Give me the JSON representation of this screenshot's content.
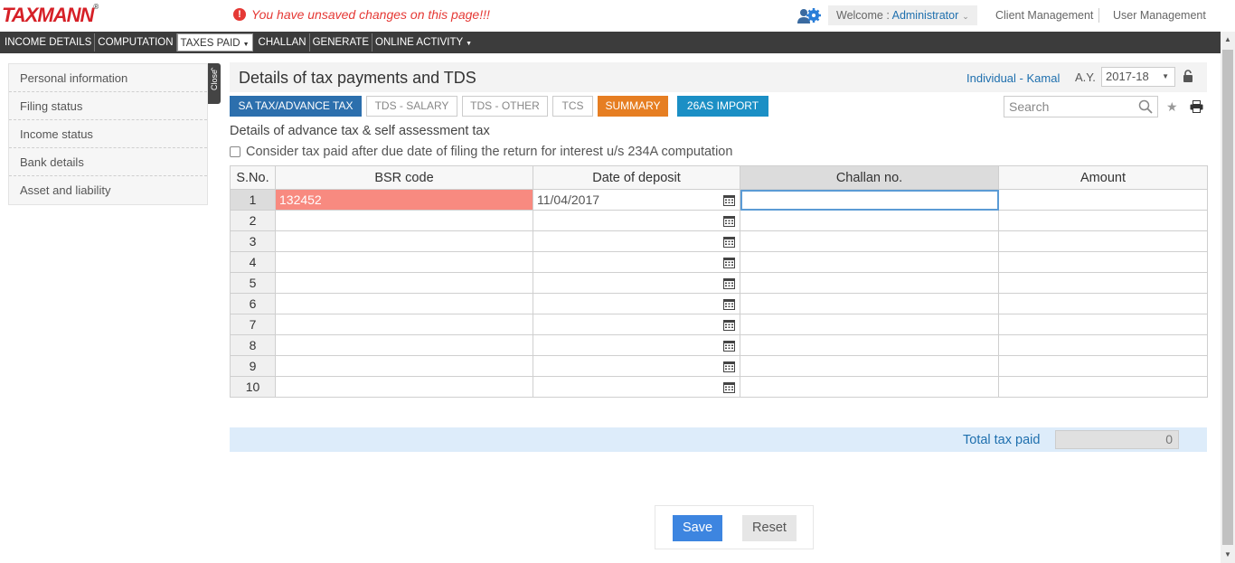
{
  "header": {
    "logo": "TAXMANN",
    "logo_reg": "®",
    "unsaved_message": "You have unsaved changes on this page!!!",
    "welcome_prefix": "Welcome : ",
    "welcome_user": "Administrator",
    "client_management": "Client Management",
    "user_management": "User Management"
  },
  "nav": {
    "items": [
      "INCOME DETAILS",
      "COMPUTATION",
      "TAXES PAID",
      "CHALLAN",
      "GENERATE",
      "ONLINE ACTIVITY"
    ]
  },
  "sidebar": {
    "items": [
      "Personal information",
      "Filing status",
      "Income status",
      "Bank details",
      "Asset and liability"
    ],
    "close_label": "Close"
  },
  "main": {
    "title": "Details of tax payments and TDS",
    "individual": "Individual - Kamal",
    "ay_label": "A.Y.",
    "ay_value": "2017-18",
    "tabs": [
      "SA TAX/ADVANCE TAX",
      "TDS - SALARY",
      "TDS - OTHER",
      "TCS",
      "SUMMARY",
      "26AS IMPORT"
    ],
    "search_placeholder": "Search",
    "section_title": "Details of advance tax & self assessment tax",
    "checkbox_label": "Consider tax paid after due date of filing the return for interest u/s 234A computation"
  },
  "table": {
    "headers": [
      "S.No.",
      "BSR code",
      "Date of deposit",
      "Challan no.",
      "Amount"
    ],
    "rows": [
      [
        "1",
        "132452",
        "11/04/2017",
        "",
        ""
      ],
      [
        "2",
        "",
        "",
        "",
        ""
      ],
      [
        "3",
        "",
        "",
        "",
        ""
      ],
      [
        "4",
        "",
        "",
        "",
        ""
      ],
      [
        "5",
        "",
        "",
        "",
        ""
      ],
      [
        "6",
        "",
        "",
        "",
        ""
      ],
      [
        "7",
        "",
        "",
        "",
        ""
      ],
      [
        "8",
        "",
        "",
        "",
        ""
      ],
      [
        "9",
        "",
        "",
        "",
        ""
      ],
      [
        "10",
        "",
        "",
        "",
        ""
      ]
    ]
  },
  "total": {
    "label": "Total tax paid",
    "value": "0"
  },
  "actions": {
    "save": "Save",
    "reset": "Reset"
  },
  "colors": {
    "brand_red": "#d62027",
    "primary_blue": "#2c6fad",
    "summary_orange": "#e67e22",
    "import_blue": "#1b8fc5",
    "error_cell": "#f88a80"
  }
}
